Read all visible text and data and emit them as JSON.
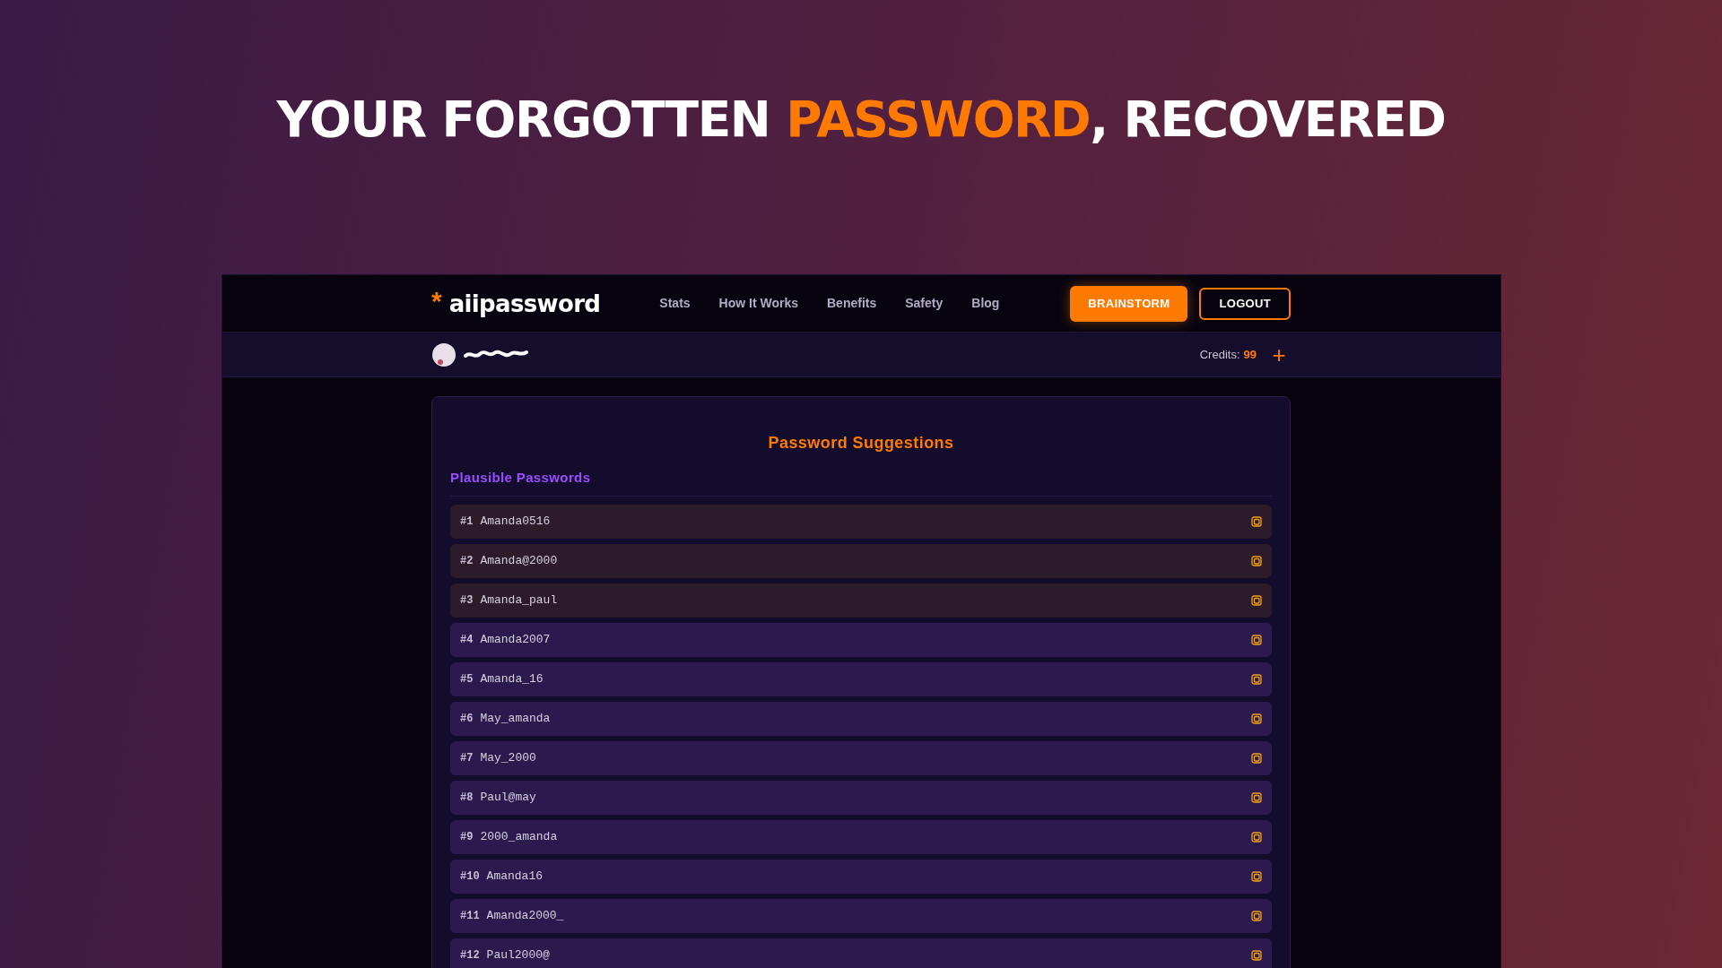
{
  "headline": [
    {
      "text": "YOUR FORGOTTEN ",
      "accent": false
    },
    {
      "text": "PASSWORD",
      "accent": true
    },
    {
      "text": ", RECOVERED",
      "accent": false
    }
  ],
  "nav": {
    "logo_mark": "*",
    "logo": "aiipassword",
    "links": [
      "Stats",
      "How It Works",
      "Benefits",
      "Safety",
      "Blog"
    ],
    "primary_button": "BRAINSTORM",
    "secondary_button": "LOGOUT"
  },
  "user_bar": {
    "credits_label": "Credits:",
    "credits": "99",
    "add_symbol": "+"
  },
  "card": {
    "title": "Password Suggestions",
    "section": "Plausible Passwords",
    "rows": [
      {
        "rank": "#1",
        "password": "Amanda0516",
        "highlighted": true
      },
      {
        "rank": "#2",
        "password": "Amanda@2000",
        "highlighted": true
      },
      {
        "rank": "#3",
        "password": "Amanda_paul",
        "highlighted": true
      },
      {
        "rank": "#4",
        "password": "Amanda2007",
        "highlighted": false
      },
      {
        "rank": "#5",
        "password": "Amanda_16",
        "highlighted": false
      },
      {
        "rank": "#6",
        "password": "May_amanda",
        "highlighted": false
      },
      {
        "rank": "#7",
        "password": "May_2000",
        "highlighted": false
      },
      {
        "rank": "#8",
        "password": "Paul@may",
        "highlighted": false
      },
      {
        "rank": "#9",
        "password": "2000_amanda",
        "highlighted": false
      },
      {
        "rank": "#10",
        "password": "Amanda16",
        "highlighted": false
      },
      {
        "rank": "#11",
        "password": "Amanda2000_",
        "highlighted": false
      },
      {
        "rank": "#12",
        "password": "Paul2000@",
        "highlighted": false
      }
    ]
  }
}
